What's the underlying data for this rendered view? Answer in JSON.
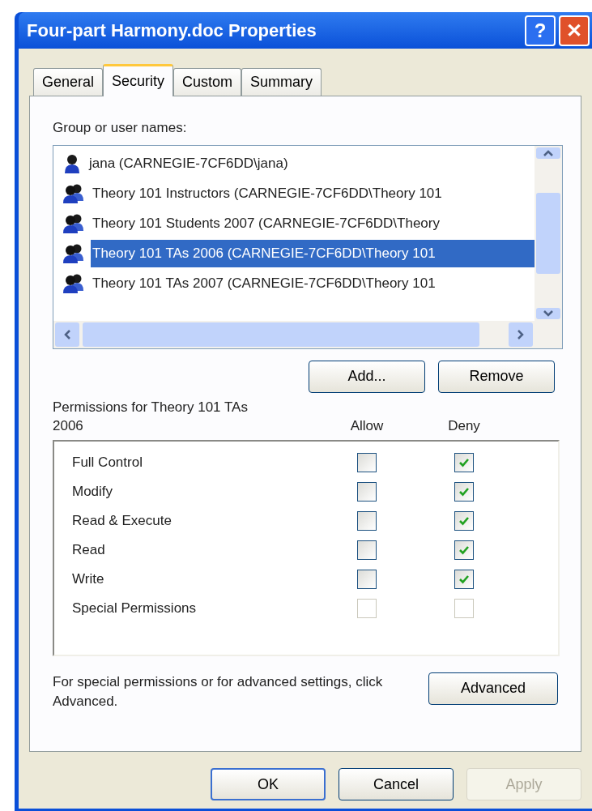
{
  "window": {
    "title": "Four-part Harmony.doc Properties",
    "title_buttons": [
      "?",
      "✕"
    ]
  },
  "tabs": [
    {
      "label": "General",
      "selected": false
    },
    {
      "label": "Security",
      "selected": true
    },
    {
      "label": "Custom",
      "selected": false
    },
    {
      "label": "Summary",
      "selected": false
    }
  ],
  "group_label": "Group or user names:",
  "users": [
    {
      "kind": "user",
      "name": "jana (CARNEGIE-7CF6DD\\jana)",
      "selected": false
    },
    {
      "kind": "group",
      "name": "Theory 101 Instructors (CARNEGIE-7CF6DD\\Theory 101",
      "selected": false
    },
    {
      "kind": "group",
      "name": "Theory 101 Students 2007 (CARNEGIE-7CF6DD\\Theory",
      "selected": false
    },
    {
      "kind": "group",
      "name": "Theory 101 TAs 2006 (CARNEGIE-7CF6DD\\Theory 101",
      "selected": true
    },
    {
      "kind": "group",
      "name": "Theory 101 TAs 2007 (CARNEGIE-7CF6DD\\Theory 101",
      "selected": false
    }
  ],
  "list_buttons": [
    {
      "label": "Add..."
    },
    {
      "label": "Remove"
    }
  ],
  "permissions": {
    "label": "Permissions for Theory 101 TAs 2006",
    "columns": [
      "Allow",
      "Deny"
    ],
    "rows": [
      {
        "name": "Full Control",
        "allow": false,
        "deny": true,
        "disabled": false
      },
      {
        "name": "Modify",
        "allow": false,
        "deny": true,
        "disabled": false
      },
      {
        "name": "Read & Execute",
        "allow": false,
        "deny": true,
        "disabled": false
      },
      {
        "name": "Read",
        "allow": false,
        "deny": true,
        "disabled": false
      },
      {
        "name": "Write",
        "allow": false,
        "deny": true,
        "disabled": false
      },
      {
        "name": "Special Permissions",
        "allow": false,
        "deny": false,
        "disabled": true
      }
    ]
  },
  "advanced": {
    "text": "For special permissions or for advanced settings, click Advanced.",
    "button": "Advanced"
  },
  "footer_buttons": [
    {
      "label": "OK",
      "disabled": false,
      "default": true
    },
    {
      "label": "Cancel",
      "disabled": false,
      "default": false
    },
    {
      "label": "Apply",
      "disabled": true,
      "default": false
    }
  ]
}
